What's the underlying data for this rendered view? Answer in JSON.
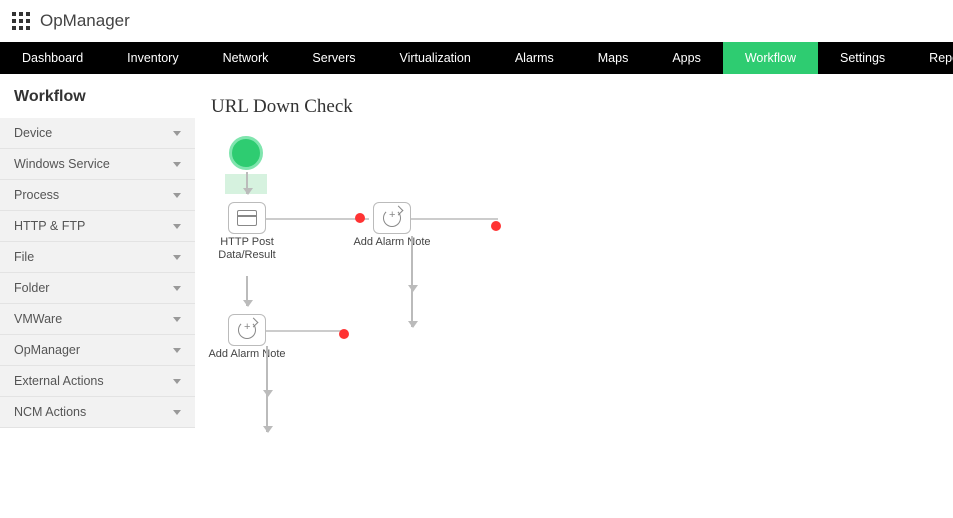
{
  "app": {
    "brand": "OpManager"
  },
  "nav": {
    "items": [
      {
        "label": "Dashboard"
      },
      {
        "label": "Inventory"
      },
      {
        "label": "Network"
      },
      {
        "label": "Servers"
      },
      {
        "label": "Virtualization"
      },
      {
        "label": "Alarms"
      },
      {
        "label": "Maps"
      },
      {
        "label": "Apps"
      },
      {
        "label": "Workflow"
      },
      {
        "label": "Settings"
      },
      {
        "label": "Reports"
      }
    ],
    "active": "Workflow"
  },
  "sidebar": {
    "title": "Workflow",
    "items": [
      {
        "label": "Device"
      },
      {
        "label": "Windows Service"
      },
      {
        "label": "Process"
      },
      {
        "label": "HTTP & FTP"
      },
      {
        "label": "File"
      },
      {
        "label": "Folder"
      },
      {
        "label": "VMWare"
      },
      {
        "label": "OpManager"
      },
      {
        "label": "External Actions"
      },
      {
        "label": "NCM Actions"
      }
    ]
  },
  "main": {
    "title": "URL Down Check",
    "nodes": {
      "n1": "HTTP Post Data/Result",
      "n2": "Add Alarm Note",
      "n3": "Add Alarm Note"
    }
  }
}
